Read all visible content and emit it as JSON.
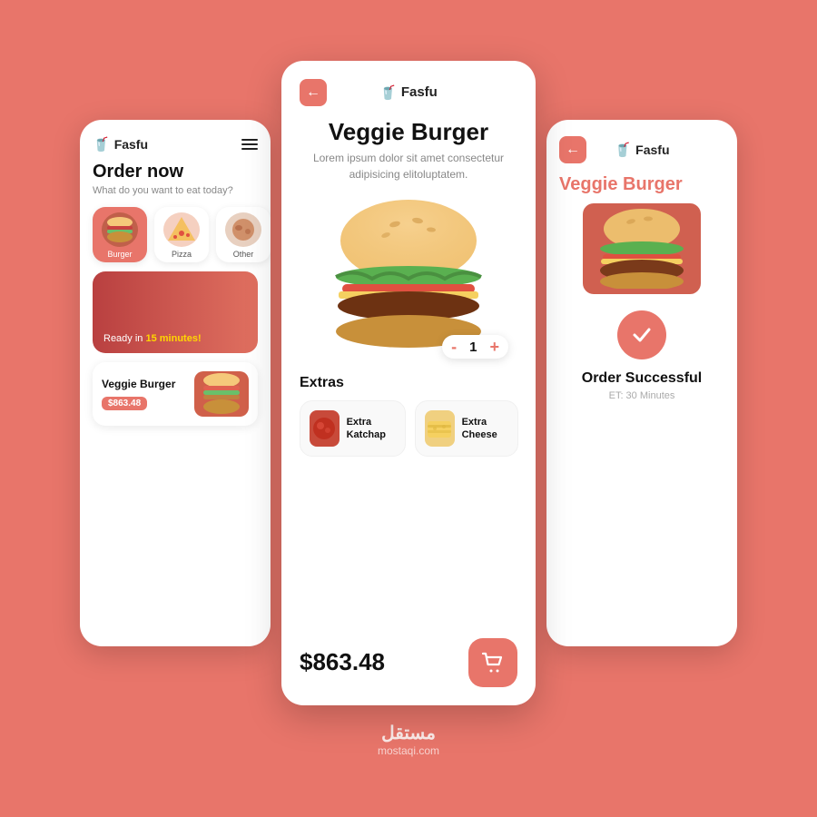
{
  "app": {
    "brand": "Fasfu",
    "brand_icon": "🥤"
  },
  "left_screen": {
    "header": {
      "brand": "Fasfu",
      "brand_icon": "🥤"
    },
    "order_title": "Order now",
    "order_subtitle": "What do you want to eat today?",
    "categories": [
      {
        "label": "Burger",
        "active": true
      },
      {
        "label": "Pizza",
        "active": false
      },
      {
        "label": "Other",
        "active": false
      }
    ],
    "ready_text": "Ready in ",
    "ready_time": "15 minutes!",
    "product": {
      "name": "Veggie Burger",
      "price": "$863.48"
    }
  },
  "middle_screen": {
    "back_icon": "←",
    "brand": "Fasfu",
    "brand_icon": "🥤",
    "product_title": "Veggie Burger",
    "product_desc": "Lorem ipsum dolor sit amet consectetur adipisicing elitoluptatem.",
    "quantity": 1,
    "quantity_minus": "-",
    "quantity_plus": "+",
    "extras_title": "Extras",
    "extras": [
      {
        "name": "Extra Katchap",
        "icon": "🍅"
      },
      {
        "name": "Extra Cheese",
        "icon": "🧀"
      }
    ],
    "price": "$863.48",
    "cart_icon": "🛒"
  },
  "right_screen": {
    "back_icon": "←",
    "brand": "Fasfu",
    "brand_icon": "🥤",
    "product_name": "Veggie Burger",
    "success_icon": "✓",
    "success_text": "Order Successful",
    "et_text": "ET: 30 Minutes"
  },
  "watermark": {
    "logo": "مستقل",
    "url": "mostaqi.com"
  }
}
